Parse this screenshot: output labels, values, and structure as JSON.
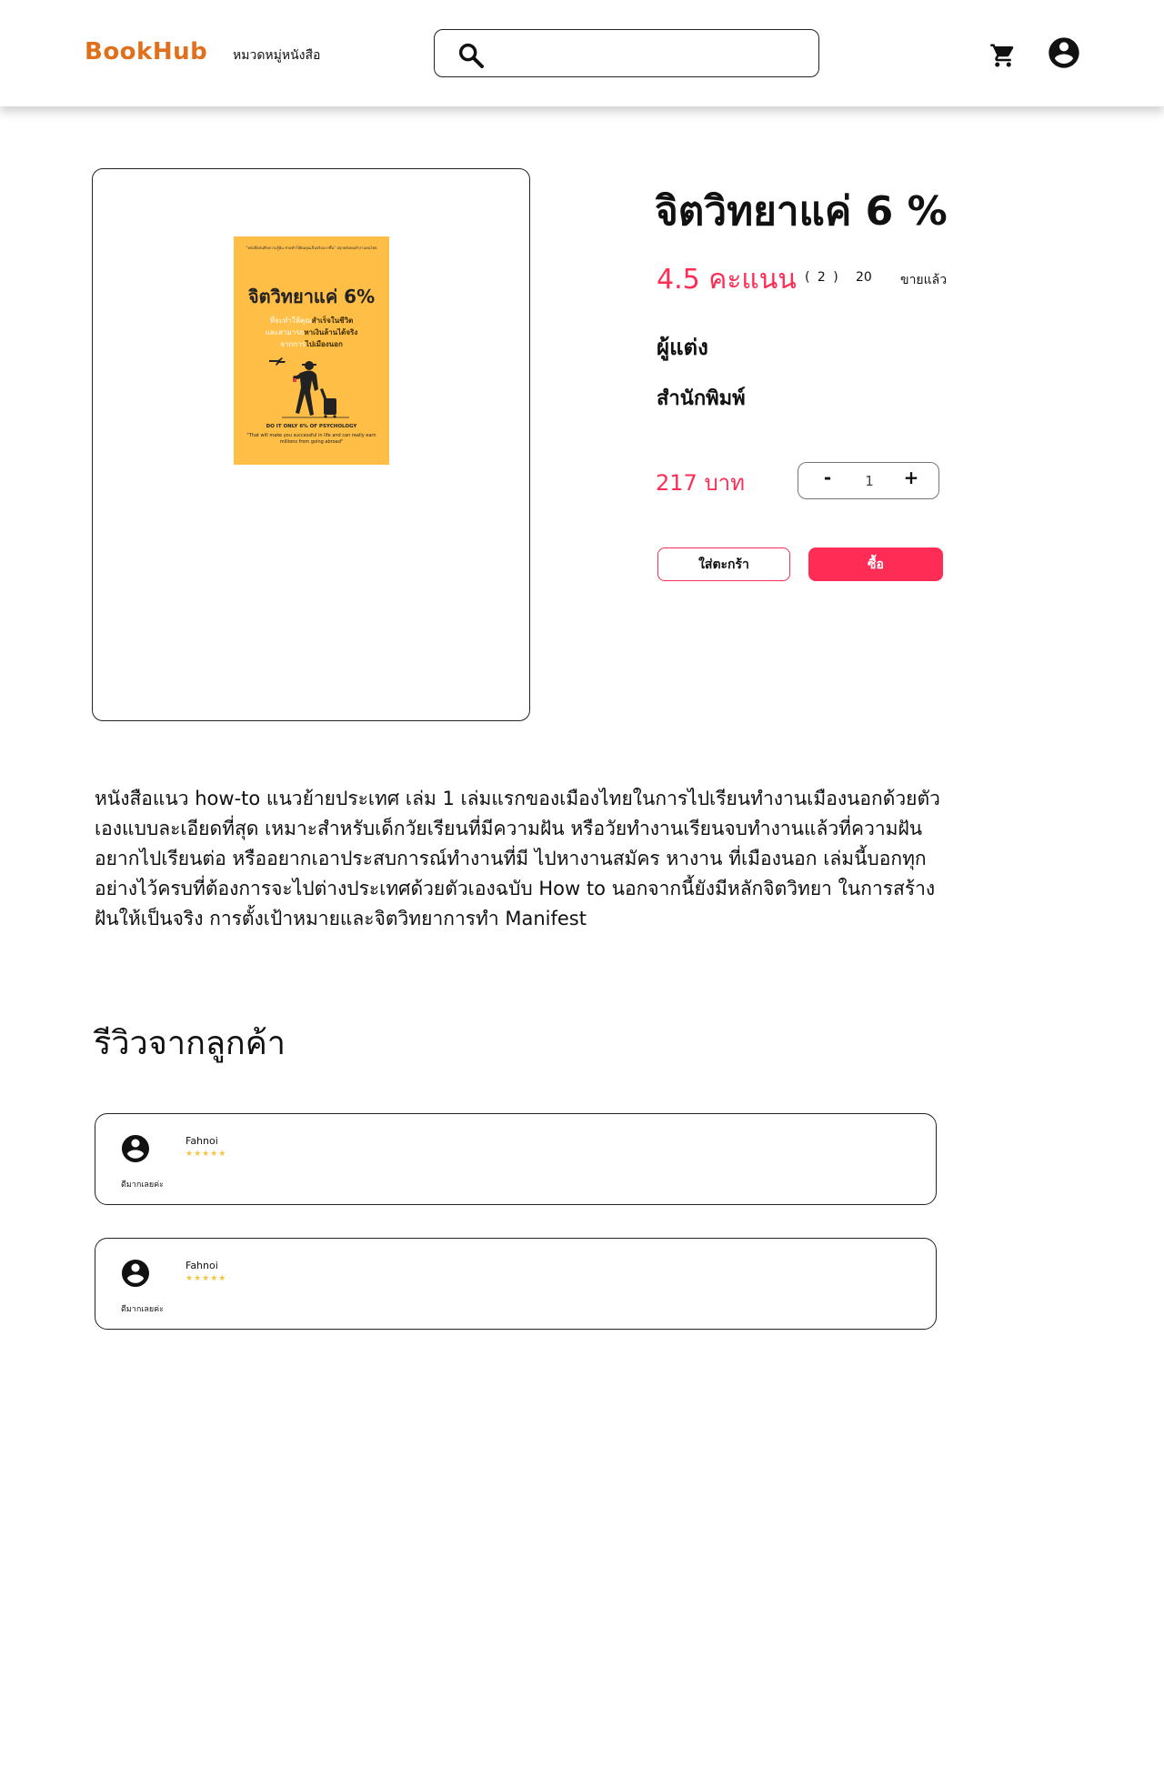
{
  "header": {
    "logo": "BookHub",
    "nav_categories": "หมวดหมู่หนังสือ",
    "search": {
      "placeholder": "",
      "value": ""
    },
    "icons": [
      "search-icon",
      "cart-icon",
      "account-icon"
    ]
  },
  "product": {
    "title": "จิตวิทยาแค่ 6 %",
    "rating_score": "4.5 คะแนน",
    "rating_count": "( 2 )",
    "sold_count": "20",
    "sold_label": "ขายแล้ว",
    "author_label": "ผู้แต่ง",
    "publisher_label": "สำนักพิมพ์",
    "price": "217 บาท",
    "quantity": {
      "minus": "-",
      "value": "1",
      "plus": "+"
    },
    "add_to_cart_label": "ใส่ตะกร้า",
    "buy_label": "ซื้อ",
    "cover": {
      "top_text": "\"หนังสือบันทึกความรู้ฝัน ช่วยทำให้ฝันคุณเป็นจริงมากขึ้น\" ปลุกพลังคนทำงานคนไทย",
      "title": "จิตวิทยาแค่ 6%",
      "subtitle_line1": "ที่จะทำให้คุณ",
      "subtitle_emph1": "สำเร็จในชีวิต",
      "subtitle_line2": "และสามารถ",
      "subtitle_emph2": "หาเงินล้านได้จริง",
      "subtitle_line3": "จากการ",
      "subtitle_emph3": "ไปเมืองนอก",
      "english_title": "DO IT ONLY 6% OF PSYCHOLOGY",
      "english_text": "\"That will make you successful in life and can really earn millions from going abroad\""
    }
  },
  "description": "หนังสือแนว how-to แนวย้ายประเทศ เล่ม 1 เล่มแรกของเมืองไทยในการไปเรียนทำงานเมืองนอกด้วยตัวเองแบบละเอียดที่สุด เหมาะสำหรับเด็กวัยเรียนที่มีความฝัน หรือวัยทำงานเรียนจบทำงานแล้วที่ความฝันอยากไปเรียนต่อ หรืออยากเอาประสบการณ์ทำงานที่มี ไปหางานสมัคร หางาน ที่เมืองนอก เล่มนี้บอกทุกอย่างไว้ครบที่ต้องการจะไปต่างประเทศด้วยตัวเองฉบับ How to นอกจากนี้ยังมีหลักจิตวิทยา ในการสร้างฝันให้เป็นจริง การตั้งเป้าหมายและจิตวิทยาการทำ Manifest",
  "reviews": {
    "heading": "รีวิวจากลูกค้า",
    "items": [
      {
        "name": "Fahnoi",
        "stars": "★★★★★",
        "rating": 5,
        "text": "ดีมากเลยค่ะ"
      },
      {
        "name": "Fahnoi",
        "stars": "★★★★★",
        "rating": 5,
        "text": "ดีมากเลยค่ะ"
      }
    ]
  },
  "colors": {
    "brand": "#E0701C",
    "accent": "#FF2D55",
    "star": "#F5C542",
    "cover": "#FFBF47"
  }
}
